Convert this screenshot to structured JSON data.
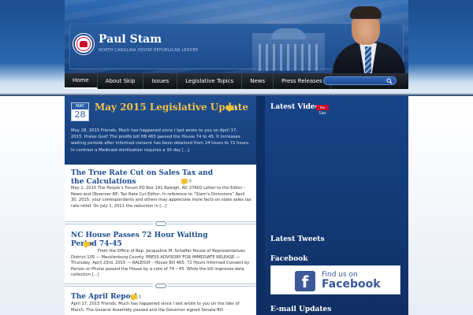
{
  "site": {
    "title": "Paul Stam",
    "subtitle": "NORTH CAROLINA HOUSE REPUBLICAN LEADER"
  },
  "nav": {
    "items": [
      {
        "label": "Home",
        "active": true
      },
      {
        "label": "About Skip"
      },
      {
        "label": "Issues"
      },
      {
        "label": "Legislative Topics"
      },
      {
        "label": "News"
      },
      {
        "label": "Press Releases"
      }
    ],
    "search_placeholder": ""
  },
  "featured": {
    "month": "MAY",
    "day": "28",
    "title": "May 2015 Legislative Update",
    "comments": "0",
    "excerpt": "May 28, 2015 Friends, Much has happened since I last wrote to you on April 17, 2015. Praise God! The prolife bill HB 465 passed the House 74 to 45. It increases waiting periods after informed consent has been obtained from 24 hours to 72 hours. In contrast a Medicaid sterilization requires a 30 day [...]"
  },
  "posts": [
    {
      "title": "The True Rate Cut on Sales Tax and the Calculations",
      "comments": "0",
      "excerpt": "May 1, 2015 The People’s Forum PO Box 191 Raleigh, NC 27602   Letter to the Editor – News and Observer RE:   Tax Rate Cut Editor:    In reference to “Stam’s Omissions” April 30, 2015, your correspondents and others may appreciate more facts on state sales tax rate relief. On July 1, 2011 the reduction in [...]"
    },
    {
      "title": "NC House Passes 72 Hour Waiting Period 74-45",
      "comments": "0",
      "excerpt": "From the Office of Rep. Jacqueline M. Schaffer House of Representatives District 105 — Mecklenburg County: PRESS ADVISORY FOR IMMEDIATE RELEASE — Thursday, April 23rd, 2015 — RALEIGH – House Bill 465: 72 Hours Informed Consent by Person or Phone passed the House by a vote of 74 – 45. While the bill improves data collection [...]"
    },
    {
      "title": "The April Report",
      "comments": "0",
      "excerpt": "April 17, 2015  Friends, Much has happened since I last wrote to you on the Ides of March. The General Assembly passed and the Governor signed Senate Bill"
    }
  ],
  "sidebar": {
    "latest_video": "Latest Video",
    "youtube_badge": "You Tube",
    "latest_tweets": "Latest Tweets",
    "facebook": "Facebook",
    "facebook_find": "Find us on",
    "facebook_brand": "Facebook",
    "email_updates": "E-mail Updates"
  },
  "colors": {
    "navy": "#0e2f63",
    "title_gold": "#f3c14a",
    "link_blue": "#1e4d8f",
    "facebook_blue": "#3b5998"
  }
}
